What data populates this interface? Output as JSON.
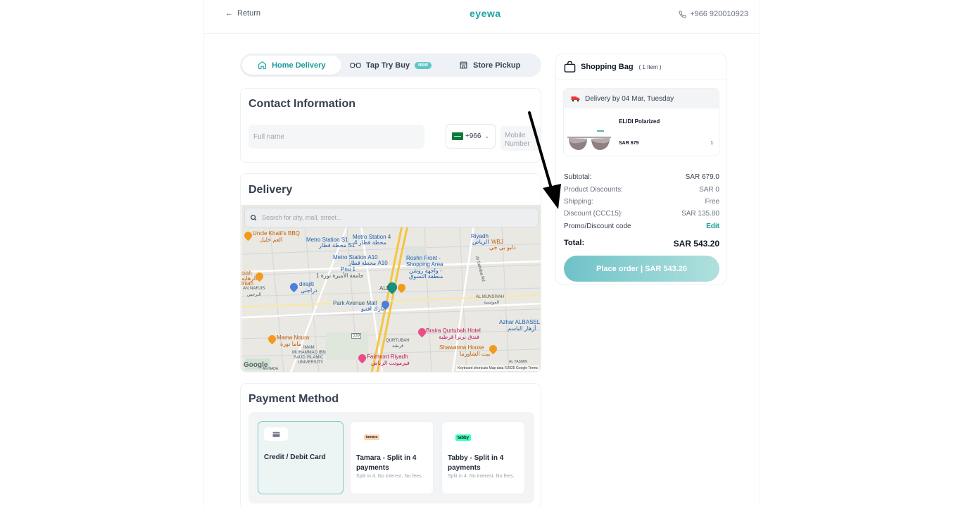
{
  "header": {
    "return_label": "Return",
    "logo": "eyewa",
    "phone": "+966 920010923"
  },
  "tabs": [
    {
      "label": "Home Delivery",
      "active": true
    },
    {
      "label": "Tap Try Buy",
      "badge": "NEW",
      "active": false
    },
    {
      "label": "Store Pickup",
      "active": false
    }
  ],
  "contact": {
    "title": "Contact Information",
    "fullname_placeholder": "Full name",
    "country_code": "+966",
    "mobile_placeholder_line1": "Mobile",
    "mobile_placeholder_line2": "Number"
  },
  "delivery": {
    "title": "Delivery",
    "search_placeholder": "Search for city, mall, street...",
    "map_labels": {
      "l1": "Uncle Khalil's BBQ",
      "l1ar": "العم خليل",
      "l2": "Metro Station S1",
      "l2ar": "محطة قطار S1",
      "l3": "Metro Station 4",
      "l3ar": "محطة قطار 4",
      "l4": "Riyadh",
      "l4ar": "الرياض",
      "l5": "WBJ",
      "l5ar": "دليو بي جي",
      "l6": "Metro Station A10",
      "l6ar": "محطة قطار A10",
      "l7": "Roshn Front -",
      "l7b": "Shopping Area",
      "l7ar": "واجهة روشن -",
      "l7ar2": "منطقة التسوق",
      "l8": "Pnu 1",
      "l8ar": "جامعة الأميرة نورة 1",
      "l9": "siah",
      "l9ar": "الرهايه",
      "l9b": "iniah",
      "l10": "AN NARJIS",
      "l10ar": "النرجس",
      "l11": "dirajiti",
      "l11ar": "دراجتي",
      "l12": "Park Avenue Mall",
      "l12ar": "بارك افنيو",
      "l13": "AL MUNSIYAH",
      "l13ar": "المونسية",
      "l14": "Azhar ALBASEL",
      "l14ar": "أزهار الباسم",
      "l15": "Braira Qurtubah Hotel",
      "l15ar": "فندق بريرا قرطبة",
      "l16": "Mama Noura",
      "l16ar": "ماما نورة",
      "l17": "QURTUBAH",
      "l17ar": "قرطبة",
      "l18": "Shawarma House",
      "l18ar": "بيت الشاورما",
      "l19": "IMAM",
      "l19b": "MUHAMMAD IBN",
      "l19c": "SAUD ISLAMIC",
      "l19d": "UNIVERSITY",
      "l20": "Fairmont Riyadh",
      "l20ar": "فيرمونت الرياض",
      "l21": "AN NADA",
      "l22": "AL YASMIN",
      "l23": "Al Sahaba Rd",
      "l24": "539",
      "l25": "ALB"
    },
    "google_label": "Google",
    "map_footer": "Keyboard shortcuts    Map data ©2025 Google    Terms"
  },
  "payment": {
    "title": "Payment Method",
    "options": [
      {
        "name": "Credit / Debit Card",
        "sub": "",
        "active": true
      },
      {
        "name": "Tamara - Split in 4 payments",
        "logo": "tamara",
        "sub": "Split in 4. No interest, No fees.",
        "active": false
      },
      {
        "name": "Tabby - Split in 4 payments",
        "logo": "tabby",
        "sub": "Split in 4. No interest, No fees.",
        "active": false
      }
    ]
  },
  "bag": {
    "title": "Shopping Bag",
    "count": "( 1 Item )",
    "delivery_banner": "Delivery by 04 Mar, Tuesday",
    "product_name": "ELIDI Polarized",
    "product_price": "SAR 679",
    "product_qty": "1",
    "summary": {
      "subtotal_label": "Subtotal:",
      "subtotal_value": "SAR 679.0",
      "product_discounts_label": "Product Discounts:",
      "product_discounts_value": "SAR 0",
      "shipping_label": "Shipping:",
      "shipping_value": "Free",
      "discount_label": "Discount (CCC15):",
      "discount_value": "SAR 135.80",
      "promo_label": "Promo/Discount code",
      "promo_action": "Edit",
      "total_label": "Total:",
      "total_value": "SAR 543.20"
    },
    "place_order_label": "Place order | SAR 543.20"
  },
  "colors": {
    "brand": "#1fa5a5",
    "button_gradient_start": "#6fc2c8",
    "button_gradient_end": "#b0e0dd"
  }
}
